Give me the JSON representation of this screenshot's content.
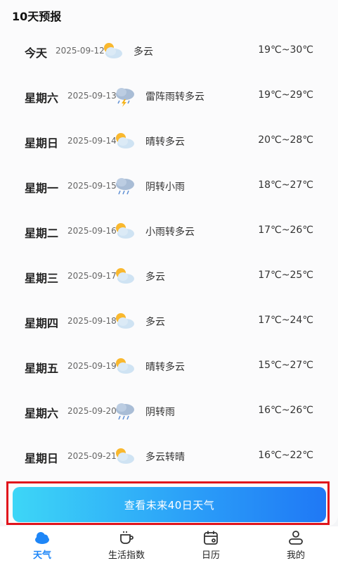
{
  "section": {
    "title": "10天预报"
  },
  "forecast": [
    {
      "day": "今天",
      "date": "2025-09-12",
      "icon": "partly-cloudy-icon",
      "condition": "多云",
      "temp": "19℃~30℃"
    },
    {
      "day": "星期六",
      "date": "2025-09-13",
      "icon": "thunder-rain-icon",
      "condition": "雷阵雨转多云",
      "temp": "19℃~29℃"
    },
    {
      "day": "星期日",
      "date": "2025-09-14",
      "icon": "partly-cloudy-icon",
      "condition": "晴转多云",
      "temp": "20℃~28℃"
    },
    {
      "day": "星期一",
      "date": "2025-09-15",
      "icon": "rain-icon",
      "condition": "阴转小雨",
      "temp": "18℃~27℃"
    },
    {
      "day": "星期二",
      "date": "2025-09-16",
      "icon": "partly-cloudy-icon",
      "condition": "小雨转多云",
      "temp": "17℃~26℃"
    },
    {
      "day": "星期三",
      "date": "2025-09-17",
      "icon": "partly-cloudy-icon",
      "condition": "多云",
      "temp": "17℃~25℃"
    },
    {
      "day": "星期四",
      "date": "2025-09-18",
      "icon": "partly-cloudy-icon",
      "condition": "多云",
      "temp": "17℃~24℃"
    },
    {
      "day": "星期五",
      "date": "2025-09-19",
      "icon": "partly-cloudy-icon",
      "condition": "晴转多云",
      "temp": "15℃~27℃"
    },
    {
      "day": "星期六",
      "date": "2025-09-20",
      "icon": "rain-icon",
      "condition": "阴转雨",
      "temp": "16℃~26℃"
    },
    {
      "day": "星期日",
      "date": "2025-09-21",
      "icon": "partly-cloudy-icon",
      "condition": "多云转晴",
      "temp": "16℃~22℃"
    }
  ],
  "cta": {
    "label": "查看未来40日天气"
  },
  "tabs": [
    {
      "label": "天气",
      "icon": "cloud-icon",
      "active": true
    },
    {
      "label": "生活指数",
      "icon": "cup-icon",
      "active": false
    },
    {
      "label": "日历",
      "icon": "calendar-icon",
      "active": false
    },
    {
      "label": "我的",
      "icon": "person-icon",
      "active": false
    }
  ],
  "colors": {
    "accent": "#1e86f7",
    "highlight_frame": "#e0141c"
  }
}
